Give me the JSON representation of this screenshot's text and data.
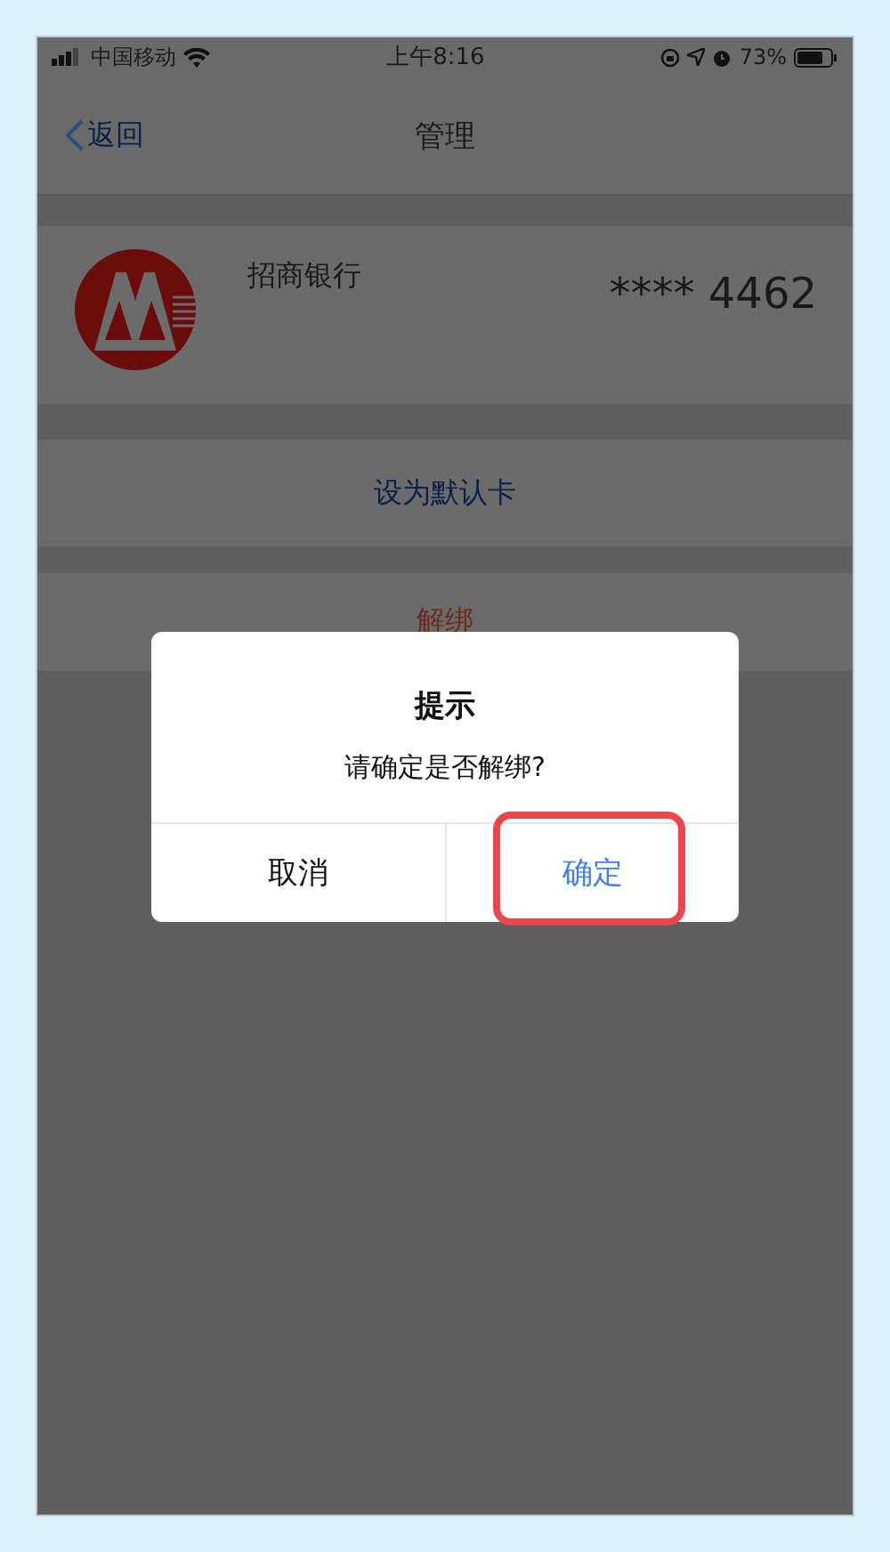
{
  "status_bar": {
    "carrier": "中国移动",
    "time": "上午8:16",
    "battery": "73%"
  },
  "nav": {
    "back": "返回",
    "title": "管理"
  },
  "card": {
    "bank": "招商银行",
    "number": "**** 4462"
  },
  "actions": [
    {
      "label": "设为默认卡",
      "kind": "primary"
    },
    {
      "label": "解绑",
      "kind": "destructive"
    }
  ],
  "dialog": {
    "title": "提示",
    "message": "请确定是否解绑?",
    "buttons": [
      {
        "label": "取消",
        "kind": "cancel",
        "annotated": false
      },
      {
        "label": "确定",
        "kind": "confirm",
        "annotated": true
      }
    ]
  }
}
